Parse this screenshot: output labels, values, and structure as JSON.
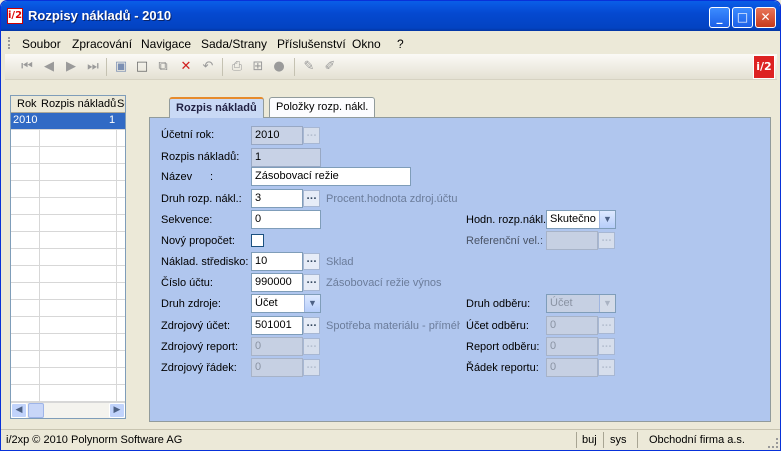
{
  "window": {
    "title": "Rozpisy nákladů - 2010",
    "logo": "i/2"
  },
  "menu": [
    "Soubor",
    "Zpracování",
    "Navigace",
    "Sada/Strany",
    "Příslušenství",
    "Okno",
    "?"
  ],
  "grid": {
    "headers": [
      "Rok",
      "Rozpis nákladů",
      "Se"
    ],
    "rows": [
      {
        "rok": "2010",
        "rozpis": "1"
      }
    ]
  },
  "tabs": [
    "Rozpis nákladů",
    "Položky rozp. nákl."
  ],
  "form": {
    "ucetni_rok": {
      "label": "Účetní rok:",
      "value": "2010"
    },
    "rozpis": {
      "label": "Rozpis nákladů:",
      "value": "1"
    },
    "nazev": {
      "label": "Název",
      "colon": ":",
      "value": "Zásobovací režie"
    },
    "druh": {
      "label": "Druh rozp. nákl.:",
      "value": "3",
      "hint": "Procent.hodnota zdroj.účtu"
    },
    "sekvence": {
      "label": "Sekvence:",
      "value": "0"
    },
    "novy": {
      "label": "Nový propočet:"
    },
    "stredisko": {
      "label": "Náklad. středisko:",
      "value": "10",
      "hint": "Sklad"
    },
    "cislo_uctu": {
      "label": "Číslo účtu:",
      "value": "990000",
      "hint": "Zásobovací režie výnos"
    },
    "druh_zdroje": {
      "label": "Druh zdroje:",
      "value": "Účet"
    },
    "zdroj_ucet": {
      "label": "Zdrojový účet:",
      "value": "501001",
      "hint": "Spotřeba materiálu - přímého"
    },
    "zdroj_report": {
      "label": "Zdrojový report:",
      "value": "0"
    },
    "zdroj_radek": {
      "label": "Zdrojový řádek:",
      "value": "0"
    },
    "hodn": {
      "label": "Hodn. rozp.nákl.",
      "value": "Skutečno"
    },
    "ref": {
      "label": "Referenční vel.:",
      "value": ""
    },
    "druh_odberu": {
      "label": "Druh odběru:",
      "value": "Účet"
    },
    "ucet_odberu": {
      "label": "Účet odběru:",
      "value": "0"
    },
    "report_odberu": {
      "label": "Report odběru:",
      "value": "0"
    },
    "radek_reportu": {
      "label": "Řádek reportu:",
      "value": "0"
    }
  },
  "status": {
    "copyright": "i/2xp © 2010 Polynorm Software AG",
    "s1": "buj",
    "s2": "sys",
    "firm": "Obchodní firma a.s."
  }
}
